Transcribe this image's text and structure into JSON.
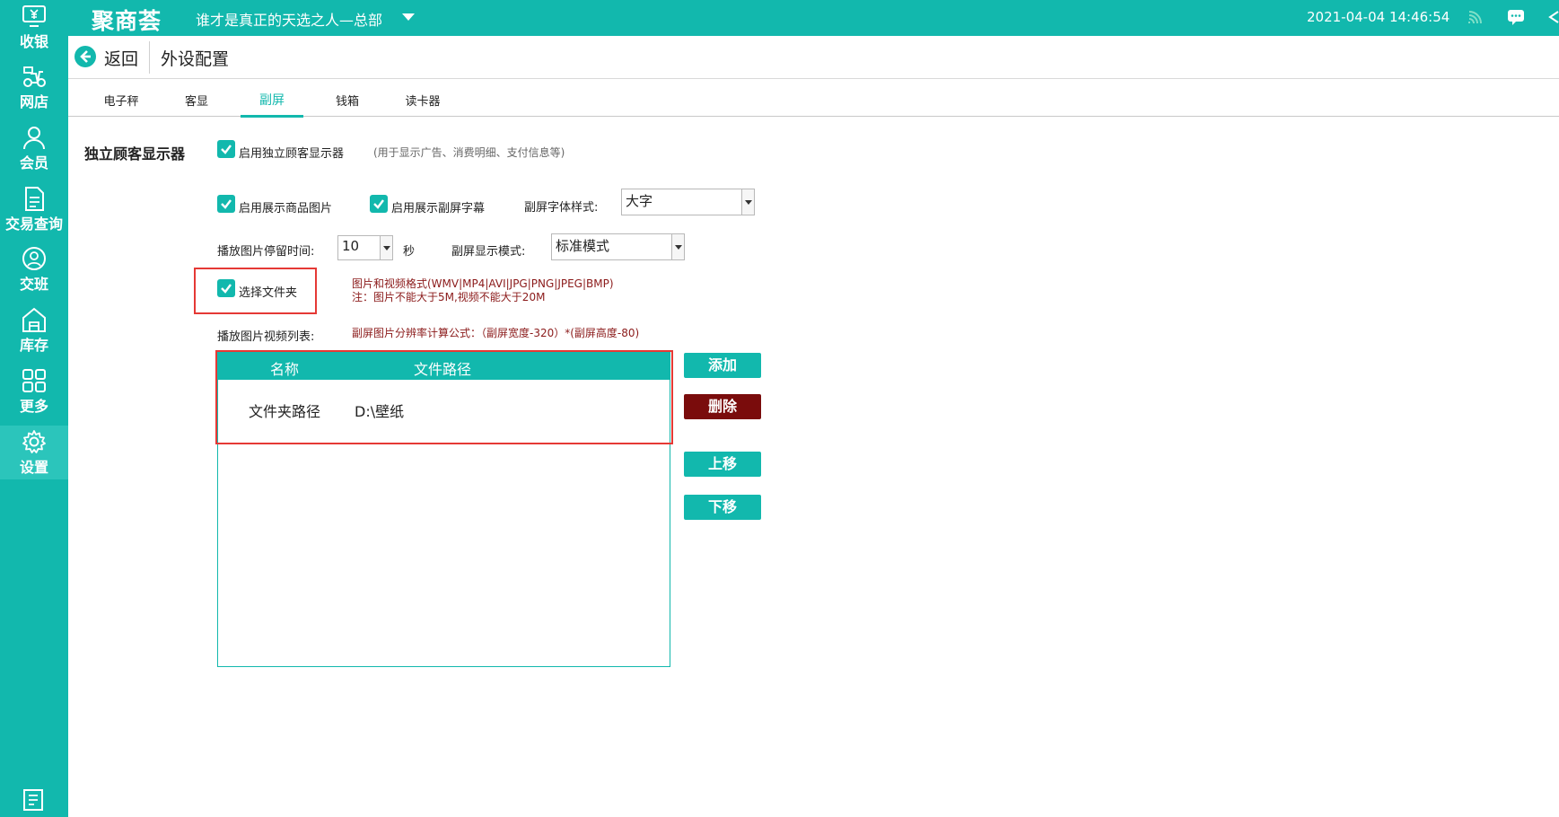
{
  "app": {
    "logo": "聚商荟",
    "store_name": "谁才是真正的天选之人—总部",
    "datetime": "2021-04-04 14:46:54"
  },
  "sidebar": {
    "items": [
      {
        "label": "收银",
        "icon": "cashier-icon"
      },
      {
        "label": "网店",
        "icon": "delivery-icon"
      },
      {
        "label": "会员",
        "icon": "member-icon"
      },
      {
        "label": "交易查询",
        "icon": "document-icon"
      },
      {
        "label": "交班",
        "icon": "shift-icon"
      },
      {
        "label": "库存",
        "icon": "warehouse-icon"
      },
      {
        "label": "更多",
        "icon": "grid-icon"
      },
      {
        "label": "设置",
        "icon": "gear-icon",
        "active": true
      }
    ]
  },
  "header": {
    "back_label": "返回",
    "title": "外设配置"
  },
  "tabs": [
    {
      "label": "电子秤"
    },
    {
      "label": "客显"
    },
    {
      "label": "副屏",
      "active": true
    },
    {
      "label": "钱箱"
    },
    {
      "label": "读卡器"
    }
  ],
  "settings": {
    "section_title": "独立顾客显示器",
    "enable_display_label": "启用独立顾客显示器",
    "enable_display_hint": "(用于显示广告、消费明细、支付信息等)",
    "show_product_image_label": "启用展示商品图片",
    "show_subtitle_label": "启用展示副屏字幕",
    "font_style_label": "副屏字体样式:",
    "font_style_value": "大字",
    "image_duration_label": "播放图片停留时间:",
    "image_duration_value": "10",
    "image_duration_unit": "秒",
    "display_mode_label": "副屏显示模式:",
    "display_mode_value": "标准模式",
    "select_folder_label": "选择文件夹",
    "format_note_line1": "图片和视频格式(WMV|MP4|AVI|JPG|PNG|JPEG|BMP)",
    "format_note_line2": "注：图片不能大于5M,视频不能大于20M",
    "playlist_label": "播放图片视频列表:",
    "resolution_formula": "副屏图片分辨率计算公式：（副屏宽度-320）*(副屏高度-80)"
  },
  "playlist_table": {
    "columns": [
      "名称",
      "文件路径"
    ],
    "rows": [
      {
        "name": "文件夹路径",
        "path": "D:\\壁纸"
      }
    ]
  },
  "buttons": {
    "add": "添加",
    "delete": "删除",
    "move_up": "上移",
    "move_down": "下移"
  },
  "colors": {
    "brand": "#12b8ad",
    "delete_button": "#7a0c0c",
    "highlight_box": "#e53935",
    "note_text": "#8b1a1a"
  }
}
